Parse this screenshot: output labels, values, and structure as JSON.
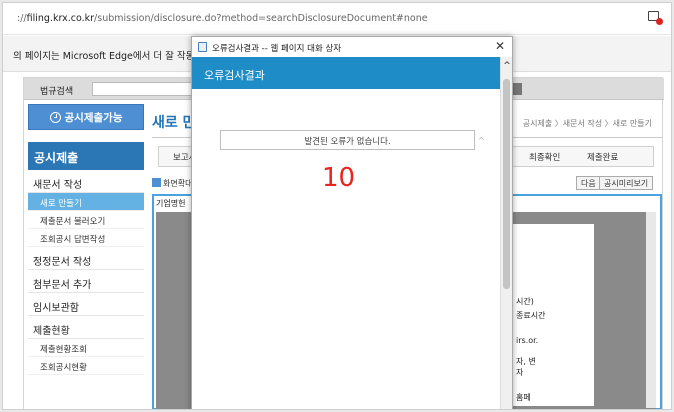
{
  "browser": {
    "url_prefix": "://",
    "url_host": "filing.krx.co.kr",
    "url_path": "/submission/disclosure.do?method=searchDisclosureDocument#none",
    "edge_notice": "의 페이지는 Microsoft Edge에서 더 잘 작동합니"
  },
  "page": {
    "top_label": "법규검색",
    "available_label": "공시제출가능",
    "menu_header": "공시제출",
    "menu": [
      {
        "type": "sec",
        "label": "새문서 작성"
      },
      {
        "type": "sub",
        "label": "새로 만들기",
        "active": true
      },
      {
        "type": "sub",
        "label": "제출문서 불러오기"
      },
      {
        "type": "sub",
        "label": "조회공시 답변작성"
      },
      {
        "type": "sec",
        "label": "정정문서 작성"
      },
      {
        "type": "sec",
        "label": "첨부문서 추가"
      },
      {
        "type": "sec",
        "label": "임시보관함"
      },
      {
        "type": "sec",
        "label": "제출현황"
      },
      {
        "type": "sub",
        "label": "제출현황조회"
      },
      {
        "type": "sub",
        "label": "조회공시현황"
      }
    ],
    "title": "새로 만",
    "breadcrumb": "공시제출 〉새문서 작성 〉새로 만들기",
    "steps": [
      "보고서",
      "최종확인",
      "제출완료"
    ],
    "expand_label": "화면확대",
    "next_button": "다음",
    "preview_button": "공시미리보기",
    "doc_company_label": "기업명헌",
    "sheet_lines": [
      "시간)",
      "종료시간",
      "irs.or.",
      "자, 변",
      "자",
      "홈페"
    ]
  },
  "dialog": {
    "window_title": "오류검사결과 -- 웹 페이지 대화 상자",
    "banner": "오류검사결과",
    "result_message": "발견된 오류가 없습니다.",
    "count": "10"
  },
  "colors": {
    "banner_blue": "#1e8cc6",
    "count_red": "#e8241e",
    "menu_header_blue": "#2b76b4",
    "active_item_blue": "#63b2e3"
  }
}
